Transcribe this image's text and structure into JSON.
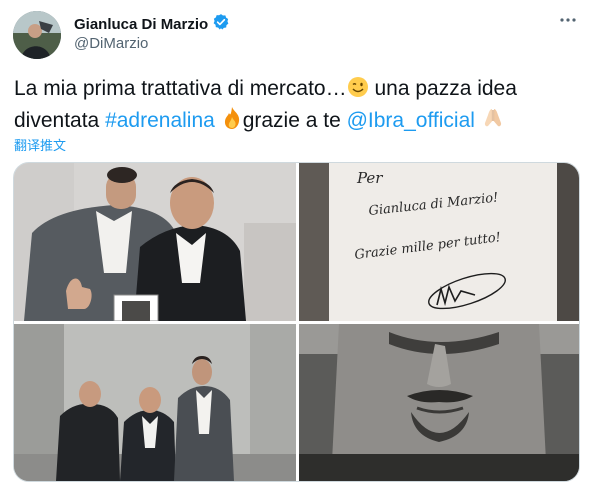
{
  "author": {
    "name": "Gianluca Di Marzio",
    "handle": "@DiMarzio",
    "verified": true
  },
  "tweet": {
    "text_part1": "La mia prima trattativa di mercato…",
    "text_part2": " una pazza idea diventata ",
    "hashtag": "#adrenalina",
    "text_part3": "grazie a te ",
    "mention": "@Ibra_official",
    "translate_label": "翻译推文"
  },
  "icons": {
    "more": "more-options-icon",
    "verified": "verified-badge-icon",
    "emoji1": "winking-face-emoji",
    "emoji2": "fire-emoji",
    "emoji3": "folded-hands-emoji"
  },
  "media": {
    "photo2_text": {
      "line1": "Per",
      "line2": "Gianluca di Marzio!",
      "line3": "Grazie mille per tutto!"
    }
  },
  "colors": {
    "link": "#1d9bf0",
    "secondary": "#536471",
    "verified": "#1d9bf0"
  }
}
